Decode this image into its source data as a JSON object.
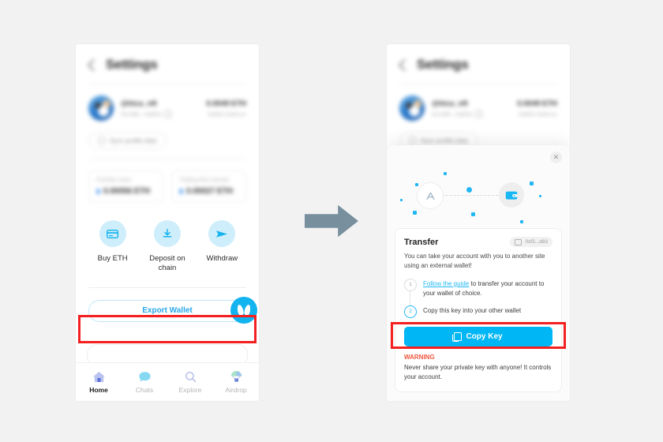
{
  "left_screen": {
    "header": {
      "title": "Settings",
      "back_icon": "chevron-left-icon"
    },
    "profile": {
      "handle": "@hica_nft",
      "address": "0x1382...ba82a",
      "balance_value": "0.0049 ETH",
      "balance_label": "Wallet balance",
      "sync_label": "Sync profile data"
    },
    "stats": [
      {
        "label": "Portfolio value",
        "value": "0.00056 ETH"
      },
      {
        "label": "Trading fees earned",
        "value": "0.00027 ETH"
      }
    ],
    "actions": [
      {
        "label": "Buy ETH",
        "icon": "credit-card-icon"
      },
      {
        "label": "Deposit on chain",
        "icon": "download-icon"
      },
      {
        "label": "Withdraw",
        "icon": "send-icon"
      }
    ],
    "export_button": "Export Wallet",
    "fab_icon": "butterfly-logo-icon",
    "nav": [
      {
        "label": "Home",
        "icon": "home-icon",
        "active": true
      },
      {
        "label": "Chats",
        "icon": "chat-bubble-icon",
        "active": false
      },
      {
        "label": "Explore",
        "icon": "magnifier-icon",
        "active": false
      },
      {
        "label": "Airdrop",
        "icon": "parachute-icon",
        "active": false
      }
    ]
  },
  "right_screen": {
    "header": {
      "title": "Settings",
      "back_icon": "chevron-left-icon"
    },
    "profile": {
      "handle": "@hica_nft",
      "address": "0x1382...ba82a",
      "balance_value": "0.0049 ETH",
      "balance_label": "Wallet balance",
      "sync_label": "Sync profile data"
    },
    "modal": {
      "close_icon": "close-icon",
      "illustration": {
        "left_icon": "app-store-icon",
        "right_icon": "wallet-icon"
      },
      "title": "Transfer",
      "address_chip": "0xf3...d83",
      "description": "You can take your account with you to another site using an external wallet!",
      "steps": [
        {
          "number": "1",
          "link": "Follow the guide",
          "text": " to transfer your account to your wallet of choice."
        },
        {
          "number": "2",
          "link": "",
          "text": "Copy this key into your other wallet"
        }
      ],
      "copy_button": "Copy Key",
      "copy_icon": "copy-icon",
      "warning_title": "WARNING",
      "warning_body": "Never share your private key with anyone! It controls your account."
    }
  },
  "annotations": {
    "arrow_icon": "right-arrow-icon",
    "highlight_color": "#f42020",
    "accent_color": "#00b6f4"
  }
}
